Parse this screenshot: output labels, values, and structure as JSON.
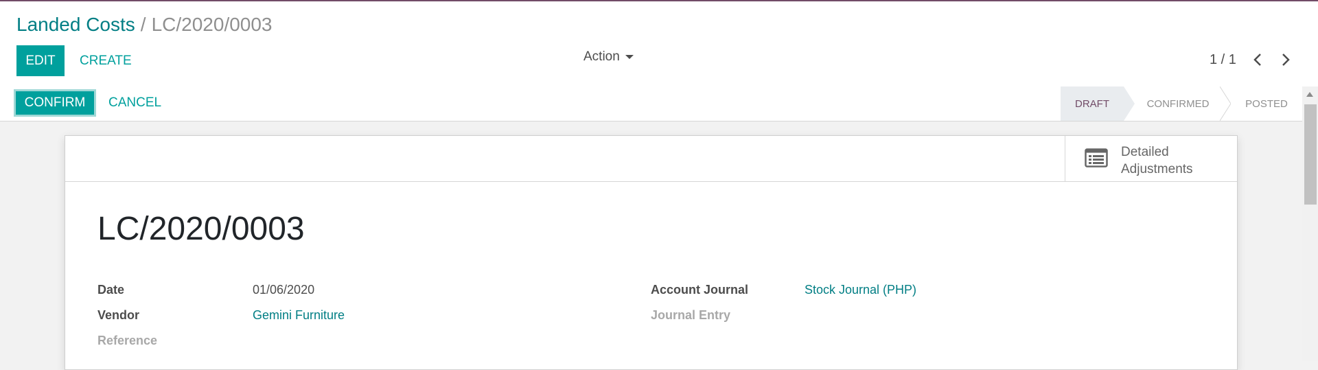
{
  "breadcrumb": {
    "parent": "Landed Costs",
    "separator": "/",
    "current": "LC/2020/0003"
  },
  "toolbar": {
    "edit_label": "EDIT",
    "create_label": "CREATE",
    "action_label": "Action"
  },
  "pager": {
    "value": "1 / 1"
  },
  "statusbar": {
    "confirm_label": "CONFIRM",
    "cancel_label": "CANCEL",
    "stages": [
      "DRAFT",
      "CONFIRMED",
      "POSTED"
    ],
    "active_stage": "DRAFT"
  },
  "smart_button": {
    "line1": "Detailed",
    "line2": "Adjustments",
    "icon": "list-icon"
  },
  "record": {
    "title": "LC/2020/0003",
    "date_label": "Date",
    "date_value": "01/06/2020",
    "vendor_label": "Vendor",
    "vendor_value": "Gemini Furniture",
    "reference_label": "Reference",
    "account_journal_label": "Account Journal",
    "account_journal_value": "Stock Journal (PHP)",
    "journal_entry_label": "Journal Entry"
  },
  "colors": {
    "primary": "#00a09d",
    "link": "#017e84",
    "brand": "#714b67"
  }
}
